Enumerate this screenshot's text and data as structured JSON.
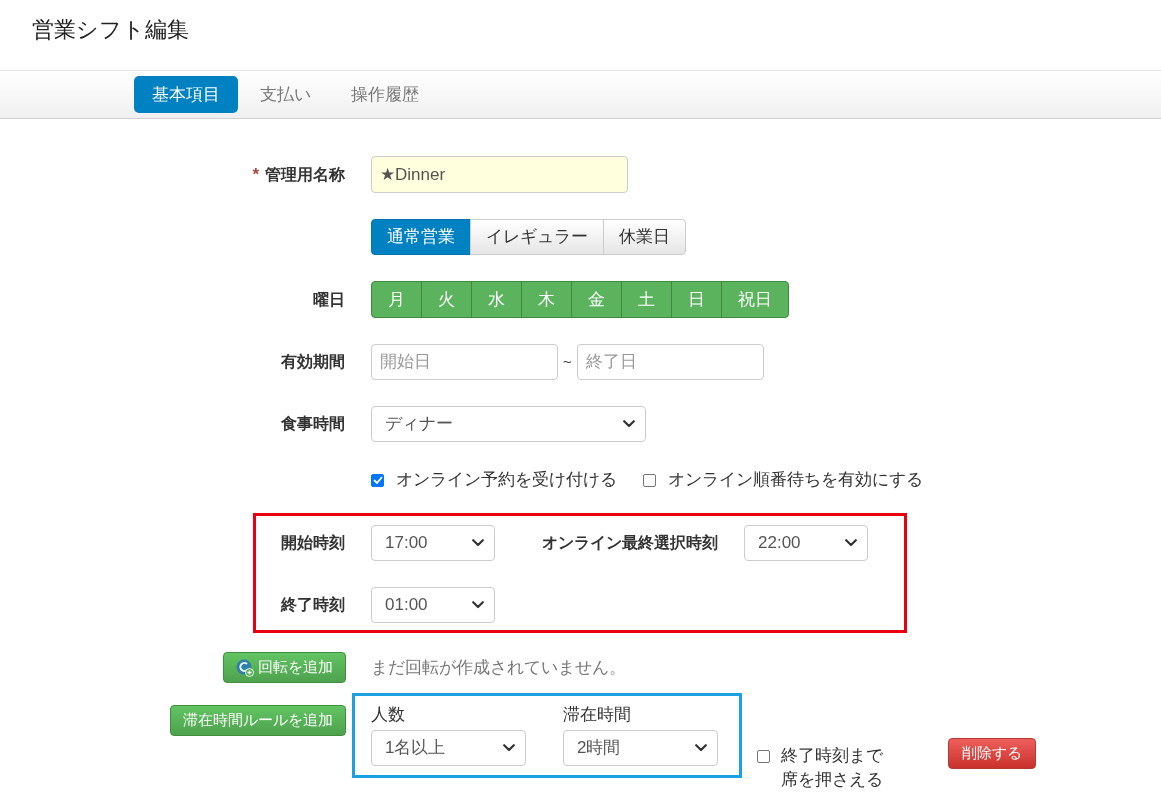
{
  "header": {
    "title": "営業シフト編集"
  },
  "tabs": [
    {
      "label": "基本項目",
      "selected": true
    },
    {
      "label": "支払い",
      "selected": false
    },
    {
      "label": "操作履歴",
      "selected": false
    }
  ],
  "form": {
    "name": {
      "required_mark": "*",
      "label": "管理用名称",
      "value": "★Dinner"
    },
    "business_types": [
      {
        "label": "通常営業",
        "selected": true
      },
      {
        "label": "イレギュラー",
        "selected": false
      },
      {
        "label": "休業日",
        "selected": false
      }
    ],
    "weekdays": {
      "label": "曜日",
      "days": [
        {
          "label": "月",
          "selected": true
        },
        {
          "label": "火",
          "selected": true
        },
        {
          "label": "水",
          "selected": true
        },
        {
          "label": "木",
          "selected": true
        },
        {
          "label": "金",
          "selected": true
        },
        {
          "label": "土",
          "selected": true
        },
        {
          "label": "日",
          "selected": true
        },
        {
          "label": "祝日",
          "selected": true
        }
      ]
    },
    "period": {
      "label": "有効期間",
      "start_placeholder": "開始日",
      "separator": "~",
      "end_placeholder": "終了日"
    },
    "meal_time": {
      "label": "食事時間",
      "value": "ディナー"
    },
    "options": [
      {
        "label": "オンライン予約を受け付ける",
        "checked": true
      },
      {
        "label": "オンライン順番待ちを有効にする",
        "checked": false
      }
    ],
    "times": {
      "start": {
        "label": "開始時刻",
        "value": "17:00"
      },
      "last_online": {
        "label": "オンライン最終選択時刻",
        "value": "22:00"
      },
      "end": {
        "label": "終了時刻",
        "value": "01:00"
      }
    },
    "rotation": {
      "button": "回転を追加",
      "message": "まだ回転が作成されていません。"
    },
    "stay_rules": {
      "button": "滞在時間ルールを追加",
      "rule": {
        "party_label": "人数",
        "party_value": "1名以上",
        "duration_label": "滞在時間",
        "duration_value": "2時間",
        "hold": {
          "label": "終了時刻まで席を押さえる",
          "checked": false
        },
        "delete_button": "削除する"
      }
    }
  }
}
